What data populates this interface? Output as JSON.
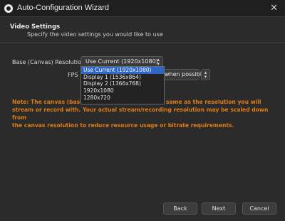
{
  "window": {
    "title": "Auto-Configuration Wizard",
    "close_glyph": "✕"
  },
  "header": {
    "title": "Video Settings",
    "subtitle": "Specify the video settings you would like to use"
  },
  "form": {
    "resolution_label": "Base (Canvas) Resolution",
    "resolution_value": "Use Current (1920x1080)",
    "fps_label": "FPS",
    "fps_value": "when possible"
  },
  "dropdown": {
    "options": [
      "Use Current (1920x1080)",
      "Display 1 (1536x864)",
      "Display 2 (1366x768)",
      "1920x1080",
      "1280x720"
    ],
    "selected": "Use Current (1920x1080)"
  },
  "note": {
    "text_left": "Note: The canvas (base",
    "text_right": " the same as the resolution you will",
    "line2": "stream or record with. Your actual stream/recording resolution may be scaled down from",
    "line3": "the canvas resolution to reduce resource usage or bitrate requirements."
  },
  "buttons": {
    "back": "Back",
    "next": "Next",
    "cancel": "Cancel"
  },
  "colors": {
    "accent_selection": "#2f67c8",
    "note_text": "#e07c14",
    "background": "#2b2b2b"
  }
}
